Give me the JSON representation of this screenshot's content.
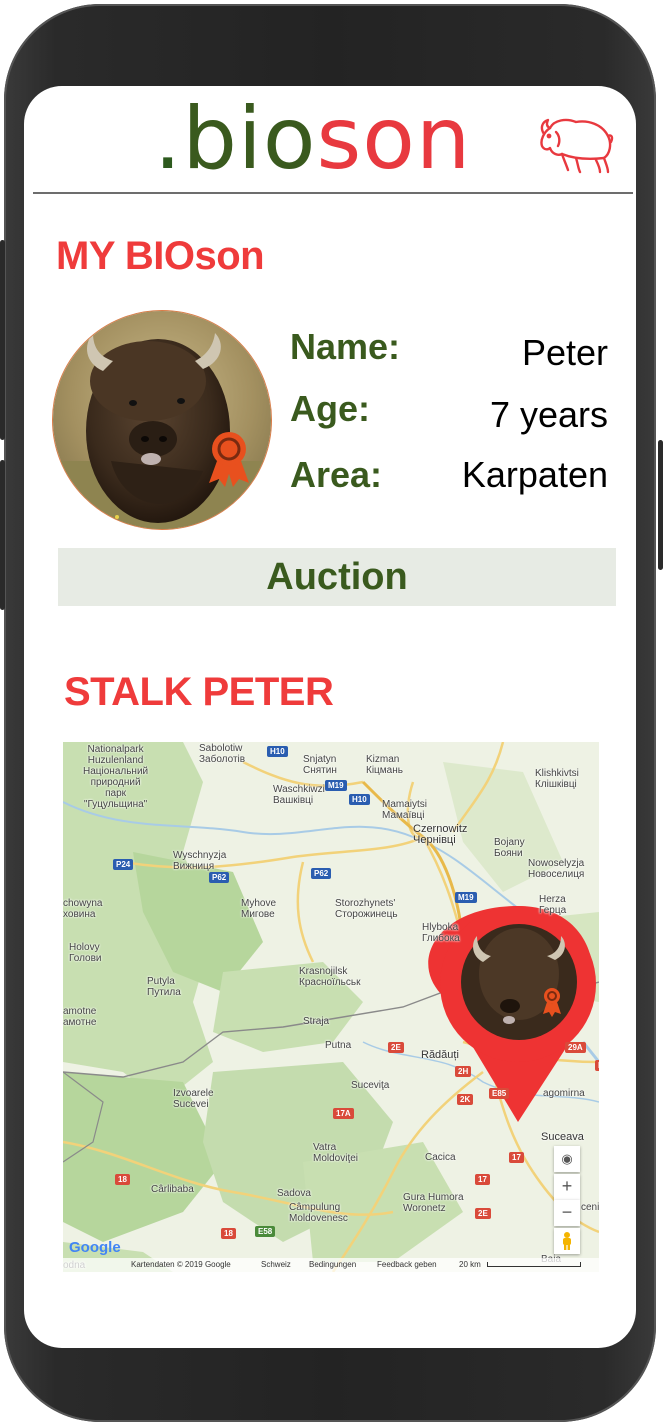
{
  "logo": {
    "dot": ".",
    "part1": "bio",
    "part2": "son"
  },
  "profile": {
    "section_title": "MY BIOson",
    "name_label": "Name:",
    "name_value": "Peter",
    "age_label": "Age:",
    "age_value": "7 years",
    "area_label": "Area:",
    "area_value": "Karpaten",
    "auction_label": "Auction"
  },
  "map_section": {
    "title": "STALK PETER",
    "places": [
      "Nationalpark\nHuzulenland\nНаціональний\nприродний\nпарк\n\"Гуцульщина\"",
      "Sabolotiw\nЗаболотів",
      "Snjatyn\nСнятин",
      "Kizman\nКіцмань",
      "Klishkivtsi\nКлішківці",
      "Waschkiwzi\nВашківці",
      "Mamaiytsi\nМамаївці",
      "Czernowitz\nЧернівці",
      "Bojany\nБояни",
      "Wyschnyzja\nВижниця",
      "Nowoselyzja\nНовоселиця",
      "Myhove\nМигове",
      "Storozhynets'\nСторожинець",
      "Herza\nГерца",
      "chowyna\nховина",
      "Hlyboka\nГлибока",
      "Holovy\nГолови",
      "Putyla\nПутила",
      "Krasnojilsk\nКрасноїльськ",
      "amotne\nамотне",
      "Straja",
      "Putna",
      "Rădăuți",
      "Suceviţa",
      "Izvoarele\nSucevei",
      "agomirna",
      "Suceava",
      "Vatra\nMoldoviţei",
      "Cacica",
      "Cârlibaba",
      "Sadova",
      "Câmpulung\nMoldovenesc",
      "Gura Humora\nWoronetz",
      "Baia",
      "ceni",
      "odna"
    ],
    "road_shields": [
      "H10",
      "M19",
      "H10",
      "P24",
      "P62",
      "P62",
      "M19",
      "2E",
      "2H",
      "2K",
      "E85",
      "17A",
      "17",
      "18",
      "18",
      "E58",
      "2E",
      "29A",
      "17",
      "E"
    ],
    "footer": {
      "copyright": "Kartendaten © 2019 Google",
      "country": "Schweiz",
      "terms": "Bedingungen",
      "feedback": "Feedback geben",
      "scale": "20 km"
    },
    "google_label": "Google",
    "zoom_in": "+",
    "zoom_out": "−"
  },
  "colors": {
    "accent_red": "#ef3b3b",
    "brand_green": "#3a5a1e",
    "pin_red": "#ee3333",
    "auction_bg": "#e7ebe4"
  },
  "icons": [
    "bison-logo-icon",
    "award-ribbon-icon",
    "map-pin-icon",
    "location-target-icon",
    "pegman-icon"
  ]
}
